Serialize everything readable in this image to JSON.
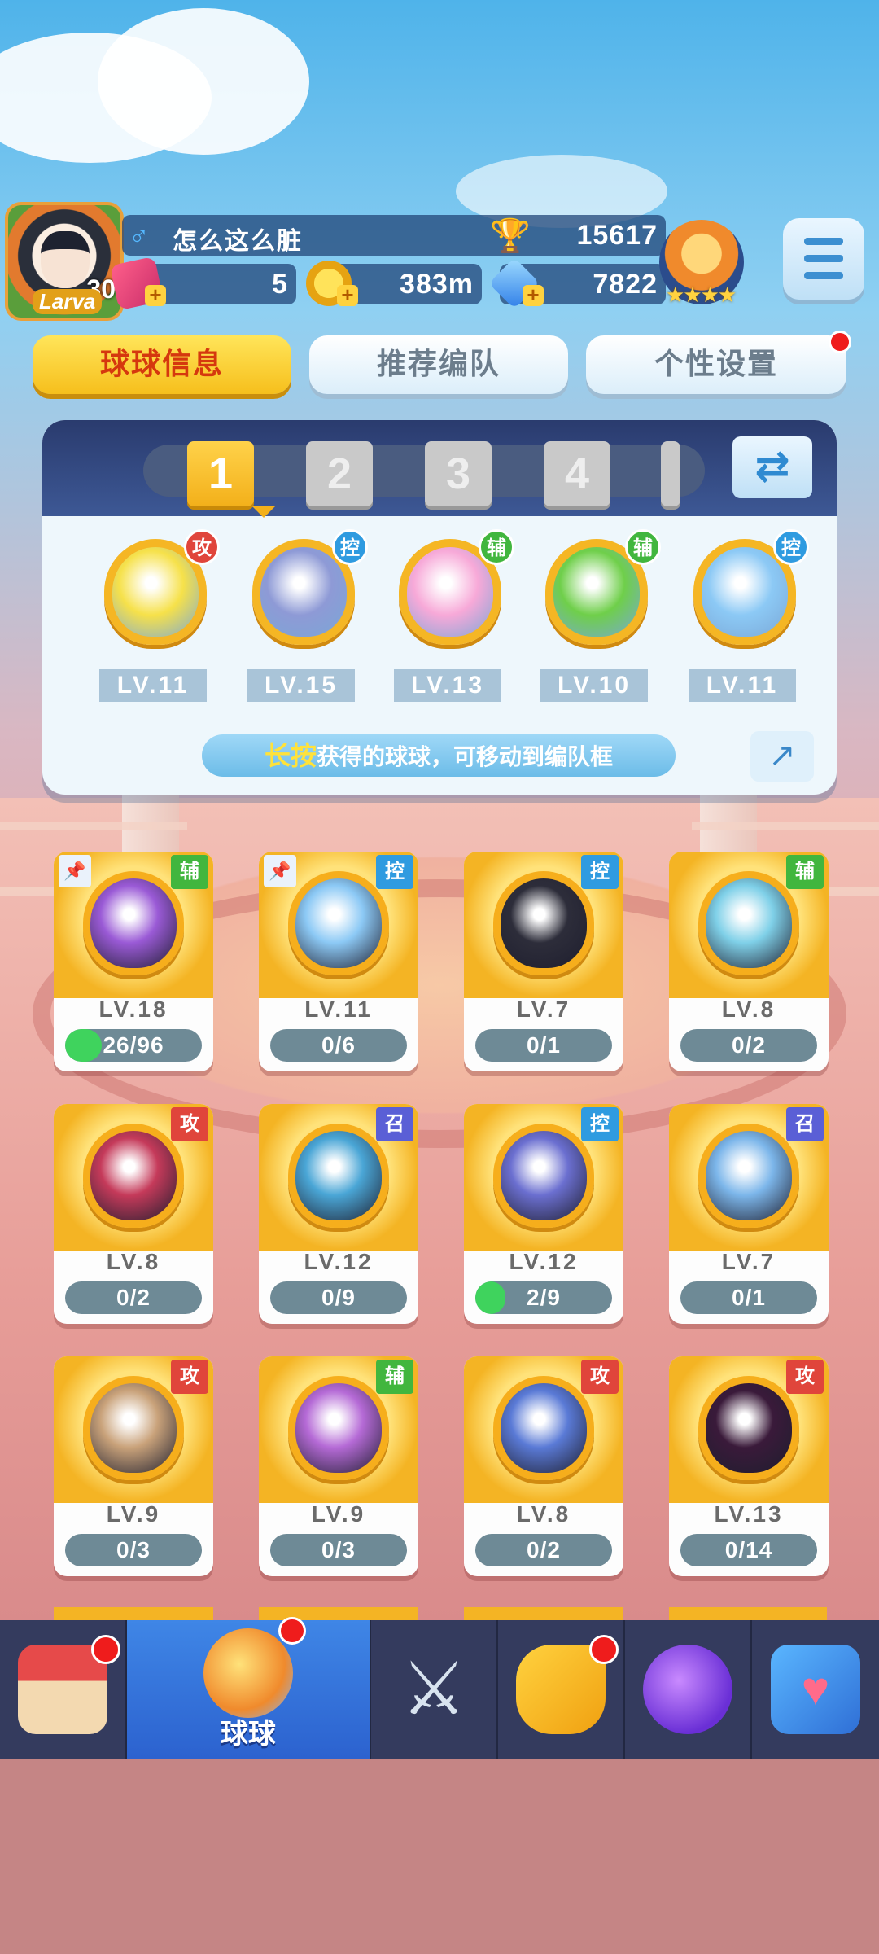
{
  "player": {
    "gender_symbol": "♂",
    "name": "怎么这么脏",
    "trophies": "15617",
    "avatar_level": "30",
    "avatar_tag": "Larva"
  },
  "resources": [
    {
      "icon": "ticket-icon",
      "value": "5"
    },
    {
      "icon": "coin-icon",
      "value": "383m"
    },
    {
      "icon": "diamond-icon",
      "value": "7822"
    }
  ],
  "tabs": [
    "球球信息",
    "推荐编队",
    "个性设置"
  ],
  "team": {
    "slots": [
      "1",
      "2",
      "3",
      "4"
    ],
    "members": [
      {
        "role": "攻",
        "level": "LV.11",
        "color": "#f6e14a"
      },
      {
        "role": "控",
        "level": "LV.15",
        "color": "#8e9ad6"
      },
      {
        "role": "辅",
        "level": "LV.13",
        "color": "#f7a9d8"
      },
      {
        "role": "辅",
        "level": "LV.10",
        "color": "#6fcf4a"
      },
      {
        "role": "控",
        "level": "LV.11",
        "color": "#8cc9f5"
      }
    ],
    "hint_key": "长按",
    "hint_text": "获得的球球，可移动到编队框"
  },
  "balls": [
    {
      "role": "辅",
      "level": "LV.18",
      "progress": "26/96",
      "ratio": 0.27,
      "pinned": true,
      "color": "#9a5ad6"
    },
    {
      "role": "控",
      "level": "LV.11",
      "progress": "0/6",
      "ratio": 0,
      "pinned": true,
      "color": "#8cc9f5"
    },
    {
      "role": "控",
      "level": "LV.7",
      "progress": "0/1",
      "ratio": 0,
      "pinned": false,
      "color": "#2d2d3a"
    },
    {
      "role": "辅",
      "level": "LV.8",
      "progress": "0/2",
      "ratio": 0,
      "pinned": false,
      "color": "#7fd0e8"
    },
    {
      "role": "攻",
      "level": "LV.8",
      "progress": "0/2",
      "ratio": 0,
      "pinned": false,
      "color": "#c53a5a"
    },
    {
      "role": "召",
      "level": "LV.12",
      "progress": "0/9",
      "ratio": 0,
      "pinned": false,
      "color": "#4aa6d6"
    },
    {
      "role": "控",
      "level": "LV.12",
      "progress": "2/9",
      "ratio": 0.22,
      "pinned": false,
      "color": "#6b6fd0"
    },
    {
      "role": "召",
      "level": "LV.7",
      "progress": "0/1",
      "ratio": 0,
      "pinned": false,
      "color": "#7cb6ea"
    },
    {
      "role": "攻",
      "level": "LV.9",
      "progress": "0/3",
      "ratio": 0,
      "pinned": false,
      "color": "#c9a27a"
    },
    {
      "role": "辅",
      "level": "LV.9",
      "progress": "0/3",
      "ratio": 0,
      "pinned": false,
      "color": "#b56ad6"
    },
    {
      "role": "攻",
      "level": "LV.8",
      "progress": "0/2",
      "ratio": 0,
      "pinned": false,
      "color": "#5a7ad6"
    },
    {
      "role": "攻",
      "level": "LV.13",
      "progress": "0/14",
      "ratio": 0,
      "pinned": false,
      "color": "#3a1a3a"
    }
  ],
  "nav": [
    {
      "icon": "shop-icon",
      "label": "",
      "badge": true
    },
    {
      "icon": "ball-icon",
      "label": "球球",
      "badge": true,
      "active": true
    },
    {
      "icon": "crossed-swords-icon",
      "label": "",
      "badge": false
    },
    {
      "icon": "whistle-icon",
      "label": "",
      "badge": true
    },
    {
      "icon": "planet-icon",
      "label": "",
      "badge": false
    },
    {
      "icon": "chat-heart-icon",
      "label": "",
      "badge": false
    }
  ]
}
